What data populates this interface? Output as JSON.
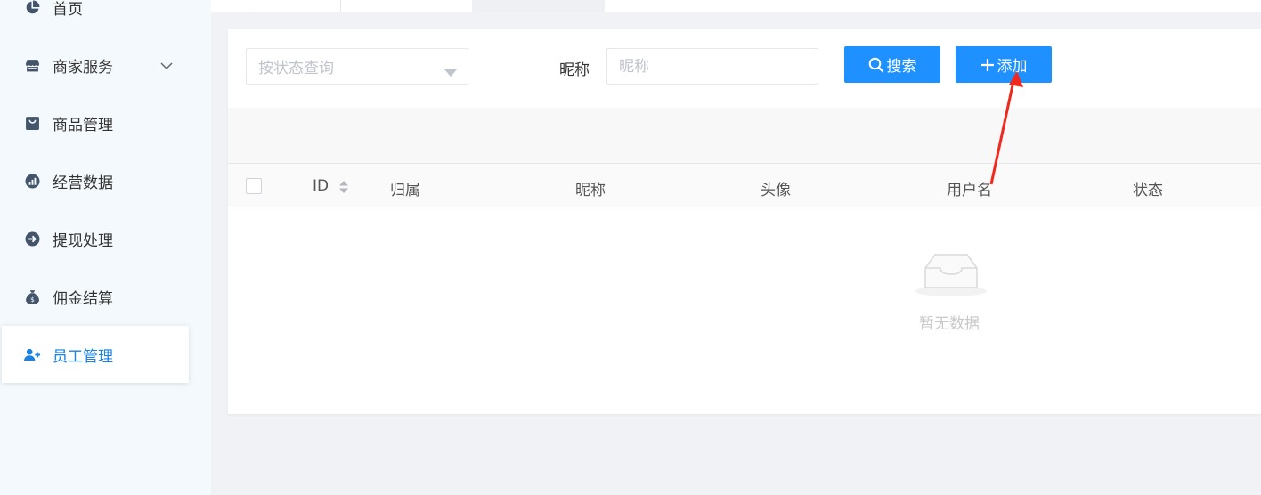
{
  "sidebar": {
    "items": [
      {
        "label": "首页",
        "icon": "pie-chart-icon"
      },
      {
        "label": "商家服务",
        "icon": "store-icon",
        "expandable": true
      },
      {
        "label": "商品管理",
        "icon": "shopping-bag-icon"
      },
      {
        "label": "经营数据",
        "icon": "bar-chart-icon"
      },
      {
        "label": "提现处理",
        "icon": "arrow-circle-icon"
      },
      {
        "label": "佣金结算",
        "icon": "money-bag-icon"
      },
      {
        "label": "员工管理",
        "icon": "user-add-icon",
        "active": true
      }
    ]
  },
  "filters": {
    "status_placeholder": "按状态查询",
    "nickname_label": "昵称",
    "nickname_placeholder": "昵称"
  },
  "buttons": {
    "search_label": "搜索",
    "add_label": "添加"
  },
  "table": {
    "columns": [
      "ID",
      "归属",
      "昵称",
      "头像",
      "用户名",
      "状态"
    ],
    "rows": [],
    "empty_text": "暂无数据"
  },
  "colors": {
    "primary": "#1e90ff",
    "active_nav": "#1a82e2",
    "annotation_arrow": "#f0281e"
  }
}
